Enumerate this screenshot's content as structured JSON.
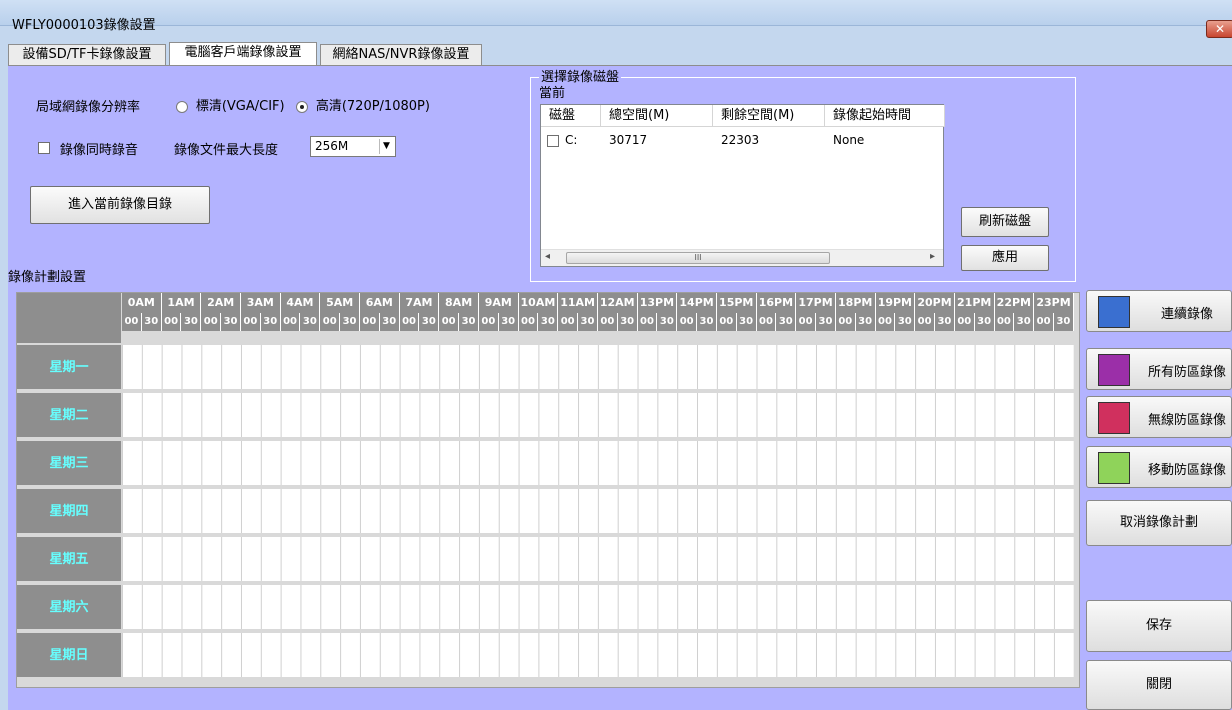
{
  "window": {
    "title": "WFLY0000103錄像設置",
    "close_label": "✕"
  },
  "tabs": [
    {
      "label": "設備SD/TF卡錄像設置"
    },
    {
      "label": "電腦客戶端錄像設置"
    },
    {
      "label": "網絡NAS/NVR錄像設置"
    }
  ],
  "resolution": {
    "label": "局域網錄像分辨率",
    "standard": "標清(VGA/CIF)",
    "hd": "高清(720P/1080P)",
    "selected": "hd"
  },
  "record_audio": {
    "label": "錄像同時錄音",
    "checked": false
  },
  "max_file": {
    "label": "錄像文件最大長度",
    "value": "256M"
  },
  "open_dir_button": "進入當前錄像目錄",
  "disk_group": {
    "title": "選擇錄像磁盤",
    "current_label": "當前",
    "columns": [
      "磁盤",
      "總空間(M)",
      "剩餘空間(M)",
      "錄像起始時間"
    ],
    "rows": [
      {
        "disk": "C:",
        "total": "30717",
        "free": "22303",
        "start": "None",
        "checked": false
      }
    ],
    "scroll_mark": "III",
    "refresh_button": "刷新磁盤",
    "apply_button": "應用"
  },
  "schedule": {
    "title": "錄像計劃設置",
    "hours": [
      "0AM",
      "1AM",
      "2AM",
      "3AM",
      "4AM",
      "5AM",
      "6AM",
      "7AM",
      "8AM",
      "9AM",
      "10AM",
      "11AM",
      "12AM",
      "13PM",
      "14PM",
      "15PM",
      "16PM",
      "17PM",
      "18PM",
      "19PM",
      "20PM",
      "21PM",
      "22PM",
      "23PM"
    ],
    "half_labels": [
      "00",
      "30"
    ],
    "days": [
      "星期一",
      "星期二",
      "星期三",
      "星期四",
      "星期五",
      "星期六",
      "星期日"
    ]
  },
  "legend": [
    {
      "label": "連續錄像",
      "color": "#3a6fd0"
    },
    {
      "label": "所有防區錄像",
      "color": "#9b2fa8"
    },
    {
      "label": "無線防區錄像",
      "color": "#d0305e"
    },
    {
      "label": "移動防區錄像",
      "color": "#8fd35a"
    }
  ],
  "actions": {
    "cancel_schedule": "取消錄像計劃",
    "save": "保存",
    "close": "關閉"
  }
}
